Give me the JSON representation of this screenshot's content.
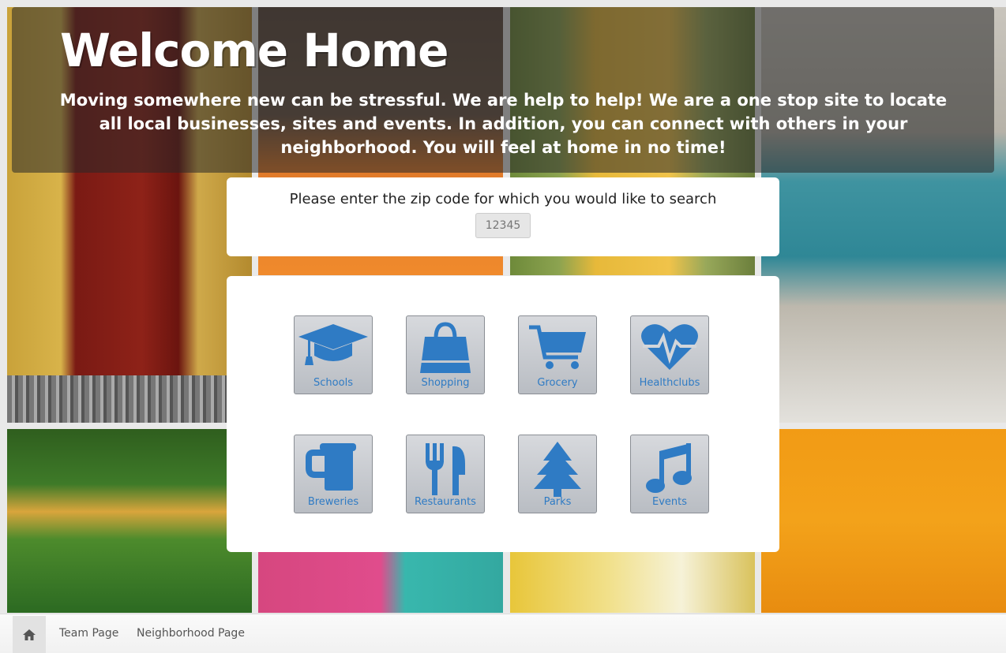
{
  "hero": {
    "title": "Welcome Home",
    "text": "Moving somewhere new can be stressful. We are help to help! We are a one stop site to locate all local businesses, sites and events. In addition, you can connect with others in your neighborhood. You will feel at home in no time!"
  },
  "zip": {
    "label": "Please enter the zip code for which you would like to search",
    "placeholder": "12345",
    "value": ""
  },
  "categories": [
    {
      "label": "Schools",
      "icon": "graduation-cap-icon"
    },
    {
      "label": "Shopping",
      "icon": "shopping-bag-icon"
    },
    {
      "label": "Grocery",
      "icon": "shopping-cart-icon"
    },
    {
      "label": "Healthclubs",
      "icon": "heartbeat-icon"
    },
    {
      "label": "Breweries",
      "icon": "beer-mug-icon"
    },
    {
      "label": "Restaurants",
      "icon": "fork-knife-icon"
    },
    {
      "label": "Parks",
      "icon": "tree-icon"
    },
    {
      "label": "Events",
      "icon": "music-note-icon"
    }
  ],
  "nav": {
    "home_icon": "home-icon",
    "items": [
      {
        "label": "Team Page"
      },
      {
        "label": "Neighborhood Page"
      }
    ]
  },
  "colors": {
    "accent_icon": "#2f7bc4",
    "overlay": "#282828"
  }
}
